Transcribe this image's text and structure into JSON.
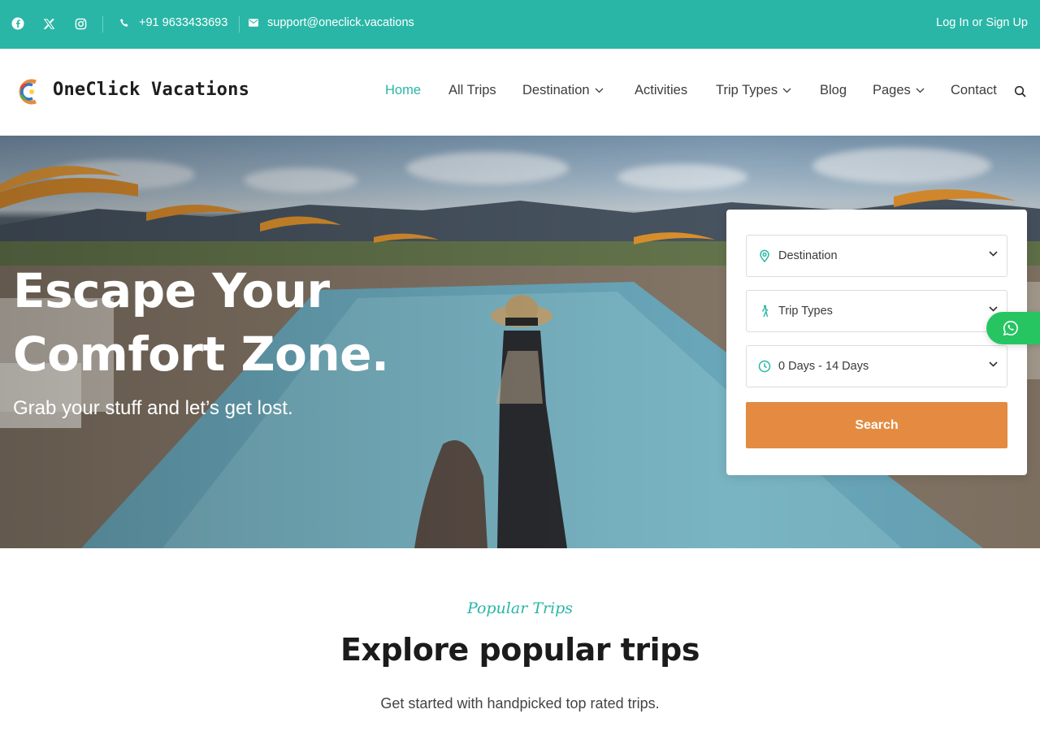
{
  "colors": {
    "accent": "#29b6a6",
    "cta": "#e48b41",
    "whatsapp": "#26c562"
  },
  "topbar": {
    "social": [
      "facebook-icon",
      "x-twitter-icon",
      "instagram-icon"
    ],
    "phone": "+91 9633433693",
    "email": "support@oneclick.vacations",
    "login": "Log In or Sign Up"
  },
  "header": {
    "site_title": "OneClick Vacations",
    "nav": [
      {
        "label": "Home",
        "active": true
      },
      {
        "label": "All Trips"
      },
      {
        "label": "Destination",
        "dropdown": true
      },
      {
        "label": "Activities"
      },
      {
        "label": "Trip Types",
        "dropdown": true
      },
      {
        "label": "Blog"
      },
      {
        "label": "Pages",
        "dropdown": true
      },
      {
        "label": "Contact"
      }
    ]
  },
  "hero": {
    "title_line1": "Escape Your",
    "title_line2": "Comfort Zone.",
    "subtitle": "Grab your stuff and let’s get lost."
  },
  "search": {
    "destination": "Destination",
    "trip_types": "Trip Types",
    "duration": "0 Days - 14 Days",
    "button": "Search"
  },
  "popular": {
    "eyebrow": "Popular Trips",
    "title": "Explore popular trips",
    "subtitle": "Get started with handpicked top rated trips."
  }
}
